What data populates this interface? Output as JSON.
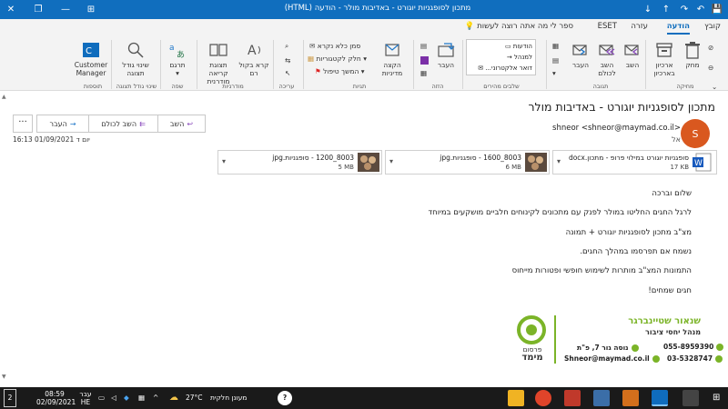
{
  "window": {
    "title": "מתכון לסופגניות יוגורט - באדיבות מולר  -  הודעה (HTML)",
    "controls": {
      "close": "✕",
      "restore": "❐",
      "minimize": "—",
      "ribbon_options": "⊞",
      "up": "↑",
      "down": "↓",
      "help": "?",
      "save": "💾",
      "undo": "↶",
      "redo": "↷"
    }
  },
  "ribbon": {
    "tabs": [
      "קובץ",
      "הודעה",
      "עזרה",
      "ESET"
    ],
    "active_tab": "הודעה",
    "tell_me": "ספר לי מה אתה רוצה לעשות",
    "groups": {
      "delete": {
        "label": "מחיקה",
        "delete_btn": "מחק",
        "archive_btn": "ארכיון בארכיון"
      },
      "respond": {
        "label": "תגובה",
        "reply": "השב",
        "reply_all": "השב לכולם",
        "forward": "העבר"
      },
      "quick_steps": {
        "label": "שלבים מהירים",
        "items": [
          "הודעות",
          "למנהל",
          "דואר אלקטרוני..."
        ]
      },
      "move": {
        "label": "הזזה",
        "move_btn": "העבר"
      },
      "tags": {
        "label": "תגיות",
        "mark_unread": "סמן כלא נקרא",
        "categorize": "חלק לקטגוריות",
        "follow_up": "המשך טיפול",
        "assign_policy": "הקצה מדיניות"
      },
      "immersive": {
        "label": "מודרניות",
        "read_aloud": "קרא בקול רם",
        "immersive_reader": "תצוגת קריאה מודרנית"
      },
      "editing": {
        "label": "עריכה"
      },
      "language": {
        "label": "שפה",
        "translate": "תרגם"
      },
      "zoom": {
        "label": "שינוי גודל תצוגה",
        "zoom_btn": "שינוי גודל תצוגה"
      },
      "addin": {
        "label": "תוספות",
        "customer_manager": "Customer Manager"
      }
    }
  },
  "message": {
    "subject": "מתכון לסופגניות יוגורט - באדיבות מולר",
    "avatar_initial": "S",
    "sender": "shneor <shneor@maymad.co.il>",
    "to_label": "אל",
    "date": "יום ד 01/09/2021 16:13",
    "actions": {
      "reply": "השב",
      "reply_all": "השב לכולם",
      "forward": "העבר",
      "more": "···"
    },
    "attachments": [
      {
        "name": "סופגניות יוגורט במילוי פרופ - מתכון.docx",
        "size": "17 KB"
      },
      {
        "name": "8003_1600 - סופגניות.jpg",
        "size": "6 MB"
      },
      {
        "name": "8003_1200 - סופגניות.jpg",
        "size": "5 MB"
      }
    ],
    "body": [
      "שלום וברכה",
      "לרגל החגים החליטו במולר לפנק עם מתכונים לקינוחים חלביים מושקעים במיוחד",
      "מצ\"ב מתכון לסופגניות יוגורט  + תמונה",
      "נשמח אם תפרסמו במהלך החגים.",
      "התמונות המצ\"ב מותרות לשימוש חופשי ופטורות מייחוס",
      "חגים שמחים!"
    ],
    "signature": {
      "name": "שנאור שטיינברגר",
      "title": "מנהל יחסי ציבור",
      "phone1": "055-8959390",
      "phone2": "03-5328747",
      "address": "נוסה גור 7, פ\"ת",
      "email": "Shneor@maymad.co.il",
      "logo_line1": "פרסום",
      "logo_line2": "מימד"
    }
  },
  "taskbar": {
    "search_text": "מעונן חלקית",
    "temperature": "27°C",
    "time": "08:59",
    "date": "02/09/2021",
    "lang1": "עבר",
    "lang2": "HE",
    "notifications": "2"
  },
  "colors": {
    "accent": "#106ebe",
    "sig_green": "#7bb428",
    "avatar": "#d9581f"
  }
}
